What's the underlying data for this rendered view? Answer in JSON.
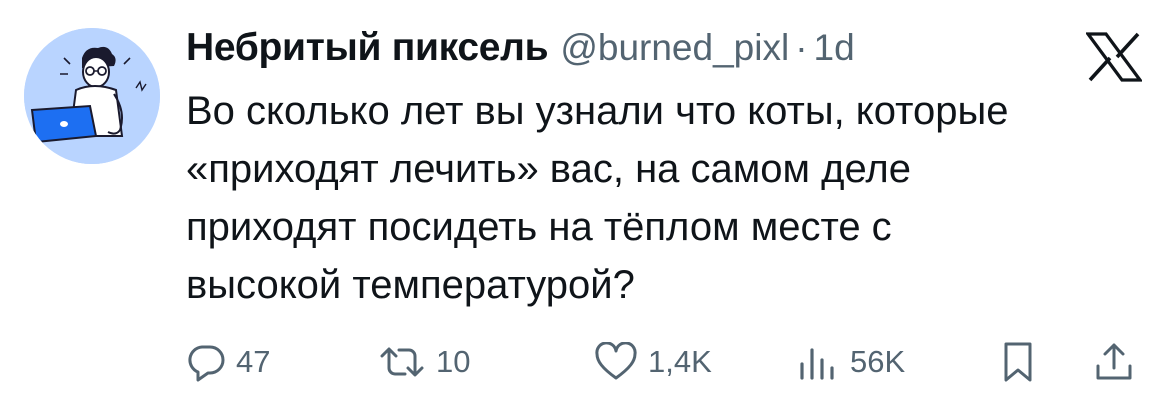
{
  "author": {
    "display_name": "Небритый пиксель",
    "handle": "@burned_pixl",
    "separator": "·",
    "time": "1d"
  },
  "tweet": {
    "text": "Во сколько лет вы узнали что коты, которые\n«приходят лечить» вас, на самом деле\nприходят посидеть на тёплом месте с\nвысокой температурой?"
  },
  "actions": {
    "replies": "47",
    "retweets": "10",
    "likes": "1,4K",
    "views": "56K"
  },
  "icons": {
    "reply": "reply-icon",
    "retweet": "retweet-icon",
    "like": "heart-icon",
    "views": "views-icon",
    "bookmark": "bookmark-icon",
    "share": "share-icon",
    "brand": "x-logo-icon"
  },
  "colors": {
    "text": "#0f1419",
    "muted": "#536471",
    "avatar_bg": "#b9d4ff",
    "laptop": "#1d6ff2"
  }
}
